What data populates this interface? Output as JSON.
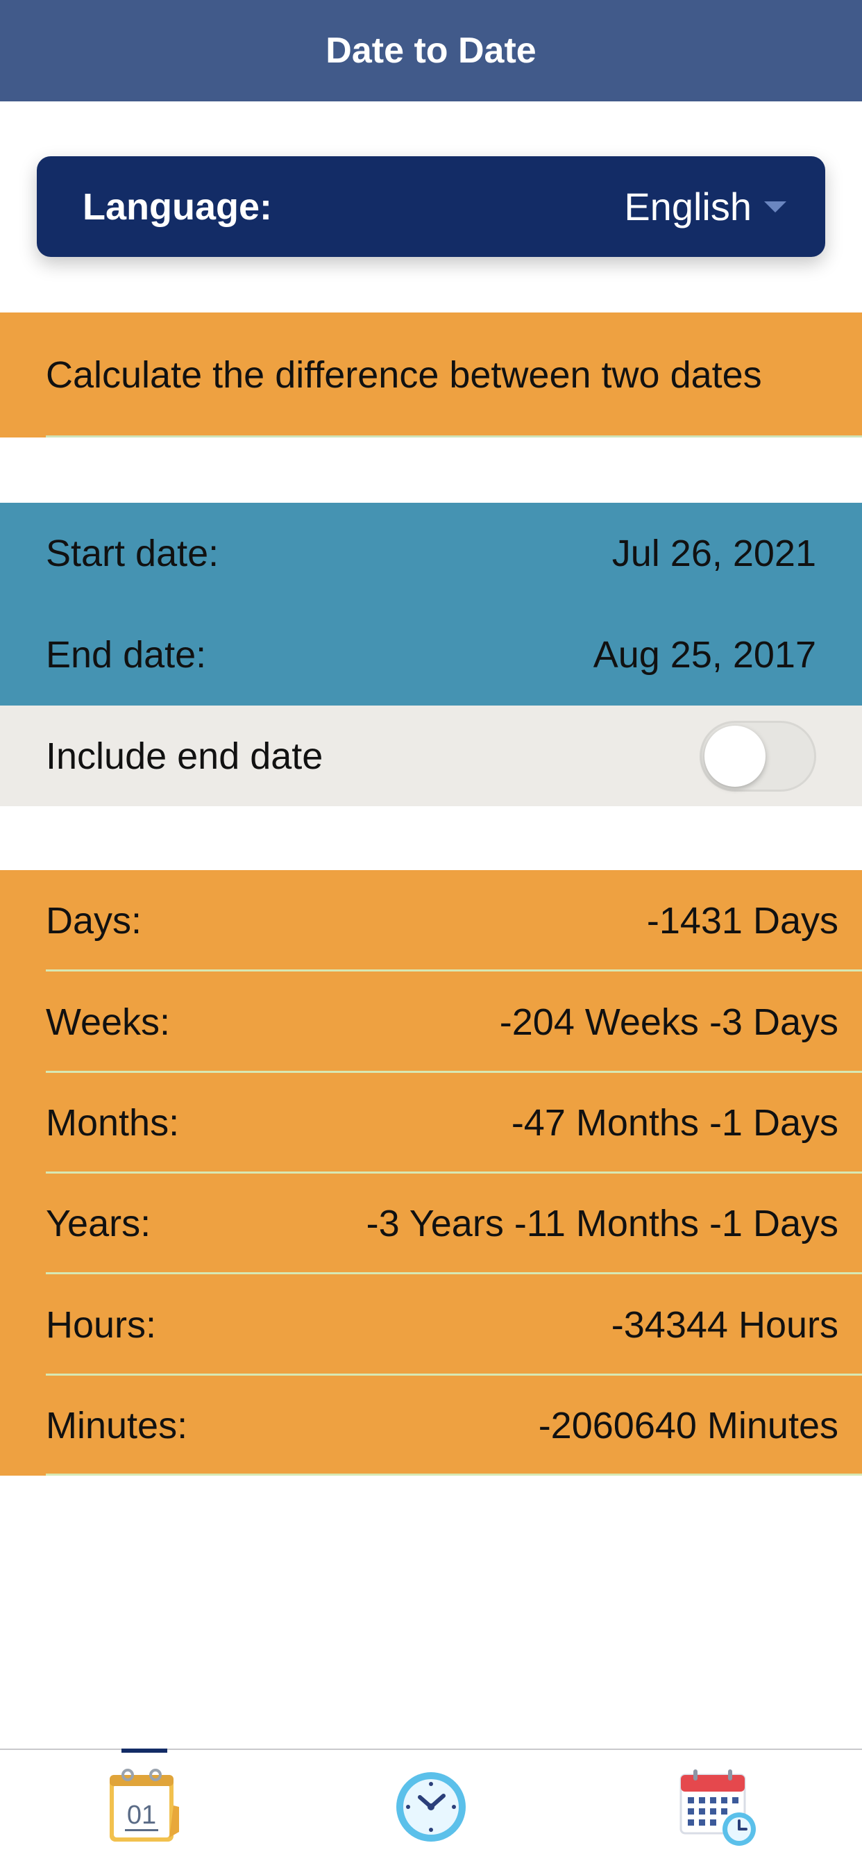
{
  "header": {
    "title": "Date to Date"
  },
  "language": {
    "label": "Language:",
    "value": "English"
  },
  "banner": {
    "text": "Calculate the difference between two dates"
  },
  "dates": {
    "start_label": "Start date:",
    "start_value": "Jul 26, 2021",
    "end_label": "End date:",
    "end_value": "Aug 25, 2017"
  },
  "include_end_date": {
    "label": "Include end date",
    "enabled": false
  },
  "results": [
    {
      "label": "Days:",
      "value": "-1431 Days"
    },
    {
      "label": "Weeks:",
      "value": "-204 Weeks -3 Days"
    },
    {
      "label": "Months:",
      "value": "-47 Months -1 Days"
    },
    {
      "label": "Years:",
      "value": "-3 Years -11 Months -1 Days"
    },
    {
      "label": "Hours:",
      "value": "-34344 Hours"
    },
    {
      "label": "Minutes:",
      "value": "-2060640 Minutes"
    }
  ],
  "tabbar": {
    "active_tab": "date-to-date",
    "tabs": [
      {
        "icon": "calendar-day-icon",
        "icon_text": "01"
      },
      {
        "icon": "clock-icon"
      },
      {
        "icon": "calendar-clock-icon"
      }
    ]
  },
  "colors": {
    "header_bg": "#415a8a",
    "language_bg": "#132c66",
    "orange": "#eea141",
    "blue": "#4593b2",
    "toggle_row_bg": "#edebe7"
  }
}
